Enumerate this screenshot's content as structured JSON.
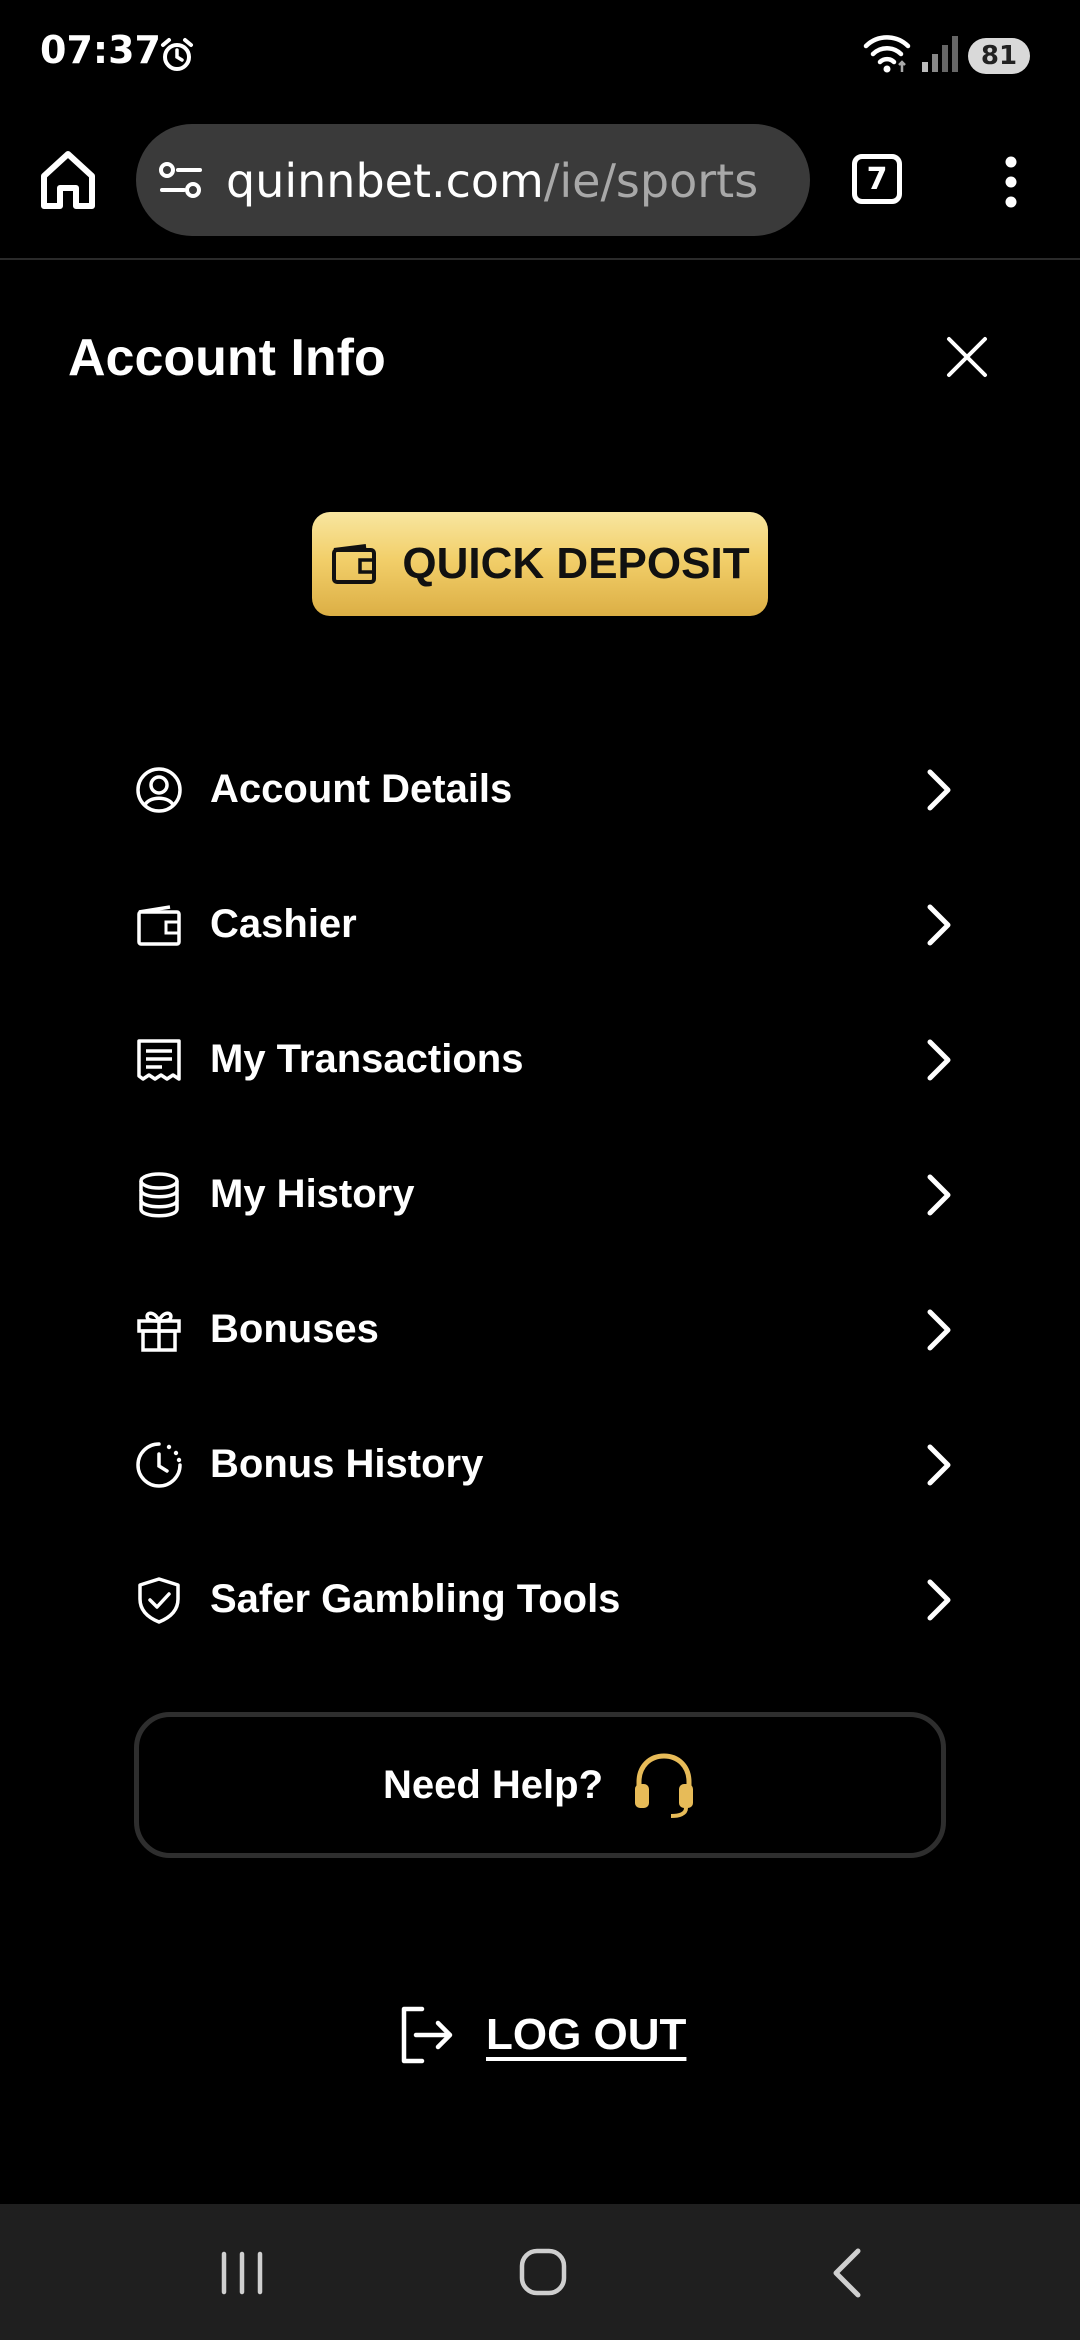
{
  "status_bar": {
    "time": "07:37",
    "battery": "81",
    "icons": [
      "alarm-icon",
      "wifi-icon",
      "signal-icon"
    ]
  },
  "browser": {
    "url_host": "quinnbet.com",
    "url_path": "/ie/sports",
    "tab_count": "7",
    "icons": [
      "home-icon",
      "site-settings-icon",
      "more-icon"
    ]
  },
  "page": {
    "title": "Account Info",
    "quick_deposit_label": "QUICK DEPOSIT",
    "menu_items": [
      {
        "label": "Account Details",
        "icon": "user-circle-icon"
      },
      {
        "label": "Cashier",
        "icon": "wallet-icon"
      },
      {
        "label": "My Transactions",
        "icon": "receipt-icon"
      },
      {
        "label": "My History",
        "icon": "database-icon"
      },
      {
        "label": "Bonuses",
        "icon": "gift-icon"
      },
      {
        "label": "Bonus History",
        "icon": "clock-history-icon"
      },
      {
        "label": "Safer Gambling Tools",
        "icon": "shield-check-icon"
      }
    ],
    "help_label": "Need Help?",
    "logout_label": "LOG OUT"
  },
  "colors": {
    "background": "#000000",
    "gold_accent": "#f2cf6a",
    "url_pill": "#3a3a3a",
    "nav_bar": "#1f1f1f"
  }
}
